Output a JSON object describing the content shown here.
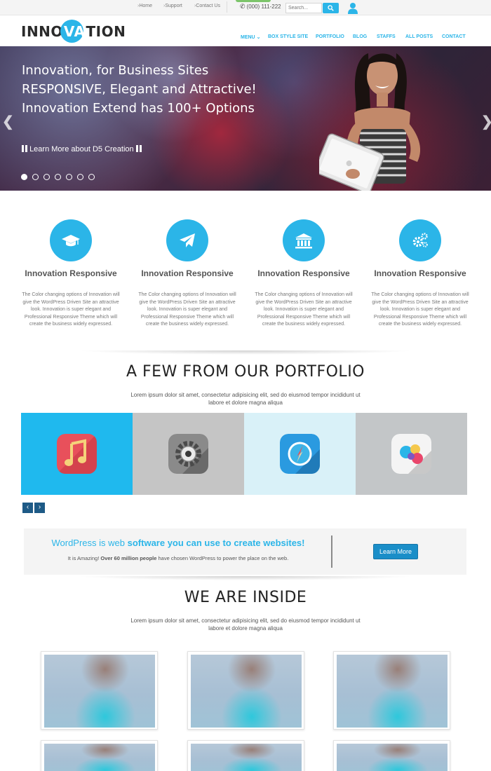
{
  "topbar": {
    "links": [
      "Home",
      "Support",
      "Contact Us"
    ],
    "phone": "(000) 111-222",
    "search_placeholder": "Search...",
    "icons": {
      "phone": "phone-icon",
      "search": "search-icon",
      "user": "user-icon"
    }
  },
  "header": {
    "logo_before": "INNO",
    "logo_highlight": "VA",
    "logo_after": "TION",
    "nav": [
      "MENU",
      "BOX STYLE SITE",
      "PORTFOLIO",
      "BLOG",
      "STAFFS",
      "ALL POSTS",
      "CONTACT"
    ]
  },
  "hero": {
    "lines": [
      "Innovation, for Business Sites",
      "RESPONSIVE, Elegant and Attractive!",
      "Innovation Extend has 100+ Options"
    ],
    "cta": "Learn More about D5 Creation",
    "slide_count": 7,
    "active_slide": 1
  },
  "features": [
    {
      "icon": "graduation-cap-icon",
      "title": "Innovation Responsive",
      "text": "The Color changing options of Innovation will give the WordPress Driven Site an attractive look. Innovation is super elegant and Professional Responsive Theme which will create the business widely expressed."
    },
    {
      "icon": "paper-plane-icon",
      "title": "Innovation Responsive",
      "text": "The Color changing options of Innovation will give the WordPress Driven Site an attractive look. Innovation is super elegant and Professional Responsive Theme which will create the business widely expressed."
    },
    {
      "icon": "bank-icon",
      "title": "Innovation Responsive",
      "text": "The Color changing options of Innovation will give the WordPress Driven Site an attractive look. Innovation is super elegant and Professional Responsive Theme which will create the business widely expressed."
    },
    {
      "icon": "gears-icon",
      "title": "Innovation Responsive",
      "text": "The Color changing options of Innovation will give the WordPress Driven Site an attractive look. Innovation is super elegant and Professional Responsive Theme which will create the business widely expressed."
    }
  ],
  "portfolio": {
    "title": "A FEW FROM OUR PORTFOLIO",
    "subtitle": "Lorem ipsum dolor sit amet, consectetur adipisicing elit, sed do eiusmod tempor incididunt ut labore et dolore magna aliqua",
    "items": [
      {
        "icon": "music-app-icon",
        "bg": "#1fb9ee"
      },
      {
        "icon": "settings-app-icon",
        "bg": "#c5c5c5"
      },
      {
        "icon": "compass-app-icon",
        "bg": "#d9f1f8"
      },
      {
        "icon": "game-center-app-icon",
        "bg": "#c3c6c8"
      }
    ],
    "prev": "‹",
    "next": "›"
  },
  "callout": {
    "headline_plain": "WordPress is web ",
    "headline_bold": "software you can use to create websites!",
    "text_before": "It is Amazing! ",
    "text_bold": "Over 60 million people",
    "text_after": " have chosen WordPress to power the place on the web.",
    "button": "Learn More"
  },
  "team": {
    "title": "WE ARE INSIDE",
    "subtitle": "Lorem ipsum dolor sit amet, consectetur adipisicing elit, sed do eiusmod tempor incididunt ut labore et dolore magna aliqua"
  },
  "colors": {
    "accent": "#2bb5e8",
    "button_dark": "#1a8ec8",
    "pager": "#1e5a86"
  }
}
